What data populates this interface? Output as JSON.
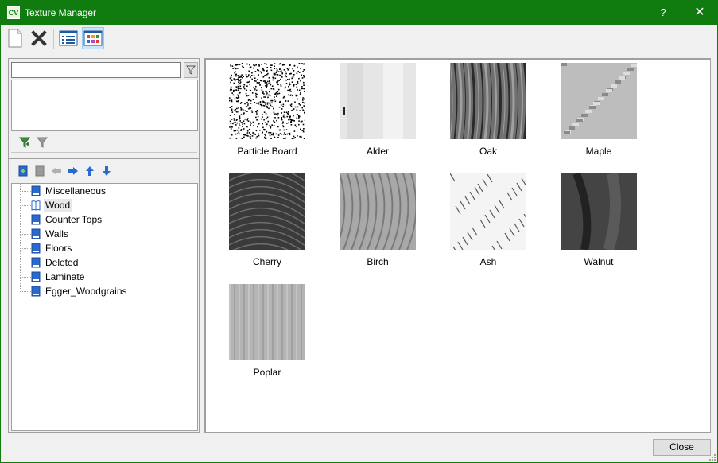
{
  "window": {
    "title": "Texture Manager",
    "app_icon_text": "CV",
    "help_glyph": "?",
    "close_glyph": "✕"
  },
  "colors": {
    "titlebar": "#107c10",
    "selection": "#cce4f7"
  },
  "toolbar": {
    "buttons": [
      {
        "name": "new-document-icon"
      },
      {
        "name": "delete-icon"
      },
      {
        "name": "list-view-icon"
      },
      {
        "name": "thumbnail-view-icon",
        "active": true
      }
    ]
  },
  "filter": {
    "search_value": "",
    "placeholder": ""
  },
  "tree": {
    "items": [
      {
        "label": "Miscellaneous",
        "selected": false
      },
      {
        "label": "Wood",
        "selected": true
      },
      {
        "label": "Counter Tops",
        "selected": false
      },
      {
        "label": "Walls",
        "selected": false
      },
      {
        "label": "Floors",
        "selected": false
      },
      {
        "label": "Deleted",
        "selected": false
      },
      {
        "label": "Laminate",
        "selected": false
      },
      {
        "label": "Egger_Woodgrains",
        "selected": false
      }
    ]
  },
  "textures": [
    {
      "label": "Particle Board"
    },
    {
      "label": "Alder"
    },
    {
      "label": "Oak"
    },
    {
      "label": "Maple"
    },
    {
      "label": "Cherry"
    },
    {
      "label": "Birch"
    },
    {
      "label": "Ash"
    },
    {
      "label": "Walnut"
    },
    {
      "label": "Poplar"
    }
  ],
  "footer": {
    "close_label": "Close"
  }
}
